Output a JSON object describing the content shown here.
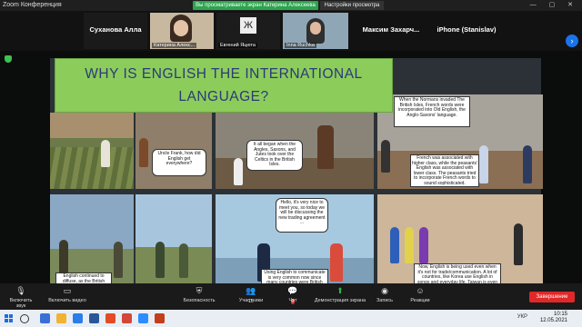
{
  "window": {
    "app_title": "Zoom Конференция",
    "controls": "— ▢ ✕"
  },
  "share_banner": "Вы просматриваете экран Катерина Алексеева",
  "view_options": "Настройки просмотра",
  "participants": [
    {
      "name": "Суханова Алла",
      "kind": "name-only"
    },
    {
      "name": "Катерина Алекс...",
      "kind": "video"
    },
    {
      "name": "Евгений Яцюта",
      "kind": "initial",
      "initial": "Ж"
    },
    {
      "name": "Inna Ruchka",
      "kind": "video"
    },
    {
      "name": "Максим Захарч...",
      "kind": "name-only"
    },
    {
      "name": "iPhone (Stanislav)",
      "kind": "name-only"
    }
  ],
  "slide": {
    "title": "WHY IS ENGLISH THE INTERNATIONAL LANGUAGE?",
    "p2_bubble": "Uncle Frank, how did English get everywhere?",
    "p3_bubble": "It all began when the Angles, Saxons, and Jutes took over the Celtics in the British Isles.",
    "p4_box_top": "When the Normans invaded The British Isles, French words were incorporated into Old English, the Anglo-Saxons' language.",
    "p4_box_bottom": "French was associated with higher class, while the peasants' English was associated with lower class. The peasants tried to incorporate French words to sound sophisticated.",
    "p5_box": "English continued to diffuse, as the British colonized and built America, and the U.S. then spread the",
    "p6_bubble": "Hello, it's very nice to meet you, so today we will be discussing the new trading agreement ...",
    "p6_box": "Using English to communicate is very common now since many countries were British colonies, so many",
    "p7_box": "Now, English is being used even when it's not for trade/communication. A lot of countries, like Korea use English in songs and everyday life. Taiwan is even making English an official language. Now that's the story of how"
  },
  "toolbar": {
    "mute": "Включить звук",
    "video": "Включить видео",
    "security": "Безопасность",
    "participants": "Участники",
    "participants_count": "15",
    "chat": "Чат",
    "chat_badge": "2",
    "share": "Демонстрация экрана",
    "record": "Запись",
    "reactions": "Реакции",
    "end": "Завершение"
  },
  "taskbar": {
    "lang": "УКР",
    "time": "10:15",
    "date": "12.05.2021"
  },
  "colors": {
    "accent": "#2da44e",
    "title_box": "#8ccc5b",
    "title_text": "#2a3a78",
    "end": "#e02828"
  }
}
